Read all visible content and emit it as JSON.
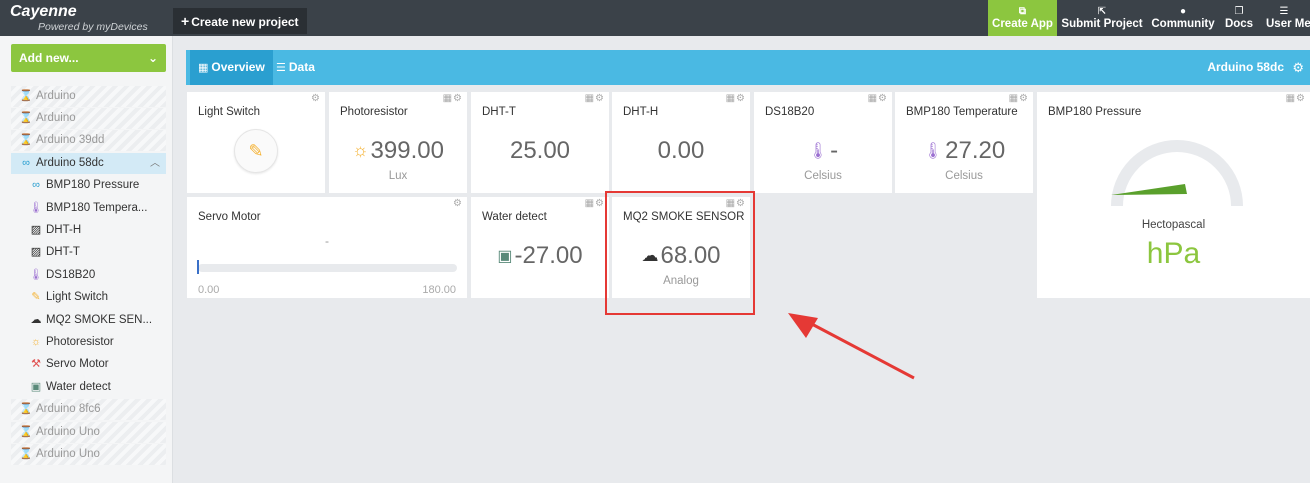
{
  "app": {
    "name": "Cayenne",
    "subtitle": "Powered by myDevices"
  },
  "toolbar": {
    "create_label": "Create new project",
    "nav": [
      {
        "label": "Create App",
        "icon": "app-icon"
      },
      {
        "label": "Submit Project",
        "icon": "external-link-icon"
      },
      {
        "label": "Community",
        "icon": "chat-icon"
      },
      {
        "label": "Docs",
        "icon": "docs-icon"
      },
      {
        "label": "User Me",
        "icon": "menu-icon"
      }
    ]
  },
  "sidebar": {
    "add_new_label": "Add new...",
    "items": [
      {
        "label": "Arduino",
        "icon": "hourglass-icon"
      },
      {
        "label": "Arduino",
        "icon": "hourglass-icon"
      },
      {
        "label": "Arduino 39dd",
        "icon": "hourglass-icon"
      },
      {
        "label": "Arduino 58dc",
        "icon": "infinity-icon"
      },
      {
        "label": "BMP180 Pressure",
        "icon": "infinity-icon"
      },
      {
        "label": "BMP180 Tempera...",
        "icon": "thermometer-icon"
      },
      {
        "label": "DHT-H",
        "icon": "sensor-icon"
      },
      {
        "label": "DHT-T",
        "icon": "sensor-icon"
      },
      {
        "label": "DS18B20",
        "icon": "thermometer-icon"
      },
      {
        "label": "Light Switch",
        "icon": "bulb-icon"
      },
      {
        "label": "MQ2 SMOKE SEN...",
        "icon": "co-icon"
      },
      {
        "label": "Photoresistor",
        "icon": "sun-icon"
      },
      {
        "label": "Servo Motor",
        "icon": "servo-icon"
      },
      {
        "label": "Water detect",
        "icon": "water-icon"
      },
      {
        "label": "Arduino 8fc6",
        "icon": "hourglass-icon"
      },
      {
        "label": "Arduino Uno",
        "icon": "hourglass-icon"
      },
      {
        "label": "Arduino Uno",
        "icon": "hourglass-icon"
      }
    ]
  },
  "content": {
    "tabs": [
      {
        "label": "Overview"
      },
      {
        "label": "Data"
      }
    ],
    "device_name": "Arduino 58dc"
  },
  "widgets": {
    "light_switch": {
      "title": "Light Switch"
    },
    "photoresistor": {
      "title": "Photoresistor",
      "value": "399.00",
      "unit": "Lux"
    },
    "dht_t": {
      "title": "DHT-T",
      "value": "25.00"
    },
    "dht_h": {
      "title": "DHT-H",
      "value": "0.00"
    },
    "ds18b20": {
      "title": "DS18B20",
      "value": "-",
      "unit": "Celsius"
    },
    "bmp180_temp": {
      "title": "BMP180 Temperature",
      "value": "27.20",
      "unit": "Celsius"
    },
    "bmp180_pressure": {
      "title": "BMP180 Pressure",
      "unit_label": "Hectopascal",
      "unit": "hPa"
    },
    "servo": {
      "title": "Servo Motor",
      "value": "-",
      "min": "0.00",
      "max": "180.00",
      "level": 0
    },
    "water": {
      "title": "Water detect",
      "value": "-27.00"
    },
    "mq2": {
      "title": "MQ2 SMOKE SENSOR",
      "value": "68.00",
      "unit": "Analog"
    }
  },
  "colors": {
    "topbar": "#3b4249",
    "accent_green": "#8cc63f",
    "accent_blue": "#4ab9e3",
    "highlight_red": "#e53935"
  }
}
